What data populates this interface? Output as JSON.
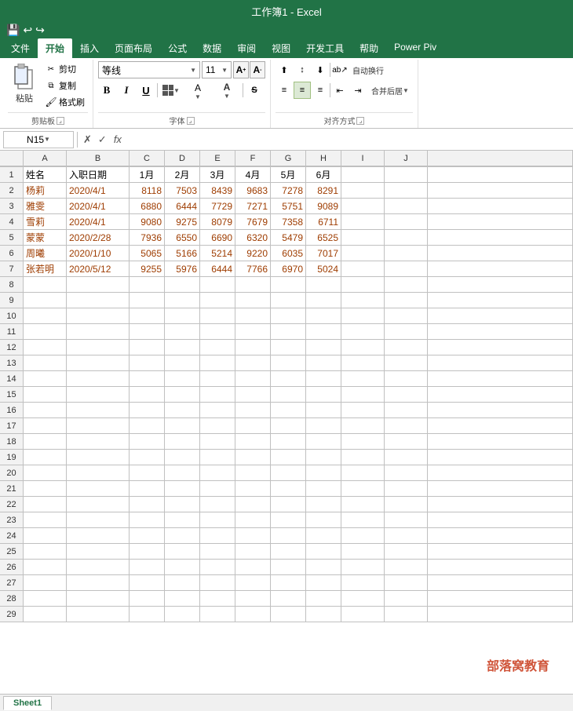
{
  "titleBar": {
    "text": "工作簿1 - Excel"
  },
  "quickAccess": {
    "save": "💾",
    "undo": "↩",
    "redo": "↪"
  },
  "tabs": [
    {
      "label": "文件",
      "active": false
    },
    {
      "label": "开始",
      "active": true
    },
    {
      "label": "插入",
      "active": false
    },
    {
      "label": "页面布局",
      "active": false
    },
    {
      "label": "公式",
      "active": false
    },
    {
      "label": "数据",
      "active": false
    },
    {
      "label": "审阅",
      "active": false
    },
    {
      "label": "视图",
      "active": false
    },
    {
      "label": "开发工具",
      "active": false
    },
    {
      "label": "帮助",
      "active": false
    },
    {
      "label": "Power Piv",
      "active": false
    }
  ],
  "clipboard": {
    "groupLabel": "剪贴板",
    "pasteLabel": "粘贴",
    "cutLabel": "剪切",
    "copyLabel": "复制",
    "brushLabel": "格式刷"
  },
  "font": {
    "groupLabel": "字体",
    "fontName": "等线",
    "fontSize": "11",
    "boldLabel": "B",
    "italicLabel": "I",
    "underlineLabel": "U"
  },
  "alignment": {
    "groupLabel": "对齐方式",
    "autoWrap": "自动换行",
    "merge": "合并后居"
  },
  "formulaBar": {
    "nameBox": "N15",
    "cancelLabel": "✗",
    "confirmLabel": "✓",
    "fxLabel": "fx"
  },
  "columns": [
    "A",
    "B",
    "C",
    "D",
    "E",
    "F",
    "G",
    "H",
    "I",
    "J"
  ],
  "colHeaders": [
    "A",
    "B",
    "C",
    "D",
    "E",
    "F",
    "G",
    "H",
    "I",
    "J"
  ],
  "rows": [
    {
      "num": 1,
      "cells": [
        "姓名",
        "入职日期",
        "1月",
        "2月",
        "3月",
        "4月",
        "5月",
        "6月",
        "",
        ""
      ]
    },
    {
      "num": 2,
      "cells": [
        "杨莉",
        "2020/4/1",
        "8118",
        "7503",
        "8439",
        "9683",
        "7278",
        "8291",
        "",
        ""
      ]
    },
    {
      "num": 3,
      "cells": [
        "雅雯",
        "2020/4/1",
        "6880",
        "6444",
        "7729",
        "7271",
        "5751",
        "9089",
        "",
        ""
      ]
    },
    {
      "num": 4,
      "cells": [
        "雪莉",
        "2020/4/1",
        "9080",
        "9275",
        "8079",
        "7679",
        "7358",
        "6711",
        "",
        ""
      ]
    },
    {
      "num": 5,
      "cells": [
        "蒙蒙",
        "2020/2/28",
        "7936",
        "6550",
        "6690",
        "6320",
        "5479",
        "6525",
        "",
        ""
      ]
    },
    {
      "num": 6,
      "cells": [
        "周曦",
        "2020/1/10",
        "5065",
        "5166",
        "5214",
        "9220",
        "6035",
        "7017",
        "",
        ""
      ]
    },
    {
      "num": 7,
      "cells": [
        "张若明",
        "2020/5/12",
        "9255",
        "5976",
        "6444",
        "7766",
        "6970",
        "5024",
        "",
        ""
      ]
    },
    {
      "num": 8,
      "cells": [
        "",
        "",
        "",
        "",
        "",
        "",
        "",
        "",
        "",
        ""
      ]
    },
    {
      "num": 9,
      "cells": [
        "",
        "",
        "",
        "",
        "",
        "",
        "",
        "",
        "",
        ""
      ]
    },
    {
      "num": 10,
      "cells": [
        "",
        "",
        "",
        "",
        "",
        "",
        "",
        "",
        "",
        ""
      ]
    },
    {
      "num": 11,
      "cells": [
        "",
        "",
        "",
        "",
        "",
        "",
        "",
        "",
        "",
        ""
      ]
    },
    {
      "num": 12,
      "cells": [
        "",
        "",
        "",
        "",
        "",
        "",
        "",
        "",
        "",
        ""
      ]
    },
    {
      "num": 13,
      "cells": [
        "",
        "",
        "",
        "",
        "",
        "",
        "",
        "",
        "",
        ""
      ]
    },
    {
      "num": 14,
      "cells": [
        "",
        "",
        "",
        "",
        "",
        "",
        "",
        "",
        "",
        ""
      ]
    },
    {
      "num": 15,
      "cells": [
        "",
        "",
        "",
        "",
        "",
        "",
        "",
        "",
        "",
        ""
      ]
    },
    {
      "num": 16,
      "cells": [
        "",
        "",
        "",
        "",
        "",
        "",
        "",
        "",
        "",
        ""
      ]
    },
    {
      "num": 17,
      "cells": [
        "",
        "",
        "",
        "",
        "",
        "",
        "",
        "",
        "",
        ""
      ]
    },
    {
      "num": 18,
      "cells": [
        "",
        "",
        "",
        "",
        "",
        "",
        "",
        "",
        "",
        ""
      ]
    },
    {
      "num": 19,
      "cells": [
        "",
        "",
        "",
        "",
        "",
        "",
        "",
        "",
        "",
        ""
      ]
    },
    {
      "num": 20,
      "cells": [
        "",
        "",
        "",
        "",
        "",
        "",
        "",
        "",
        "",
        ""
      ]
    },
    {
      "num": 21,
      "cells": [
        "",
        "",
        "",
        "",
        "",
        "",
        "",
        "",
        "",
        ""
      ]
    },
    {
      "num": 22,
      "cells": [
        "",
        "",
        "",
        "",
        "",
        "",
        "",
        "",
        "",
        ""
      ]
    },
    {
      "num": 23,
      "cells": [
        "",
        "",
        "",
        "",
        "",
        "",
        "",
        "",
        "",
        ""
      ]
    },
    {
      "num": 24,
      "cells": [
        "",
        "",
        "",
        "",
        "",
        "",
        "",
        "",
        "",
        ""
      ]
    },
    {
      "num": 25,
      "cells": [
        "",
        "",
        "",
        "",
        "",
        "",
        "",
        "",
        "",
        ""
      ]
    },
    {
      "num": 26,
      "cells": [
        "",
        "",
        "",
        "",
        "",
        "",
        "",
        "",
        "",
        ""
      ]
    },
    {
      "num": 27,
      "cells": [
        "",
        "",
        "",
        "",
        "",
        "",
        "",
        "",
        "",
        ""
      ]
    },
    {
      "num": 28,
      "cells": [
        "",
        "",
        "",
        "",
        "",
        "",
        "",
        "",
        "",
        ""
      ]
    },
    {
      "num": 29,
      "cells": [
        "",
        "",
        "",
        "",
        "",
        "",
        "",
        "",
        "",
        ""
      ]
    }
  ],
  "watermark": "部落窝教育",
  "sheetTab": "Sheet1"
}
